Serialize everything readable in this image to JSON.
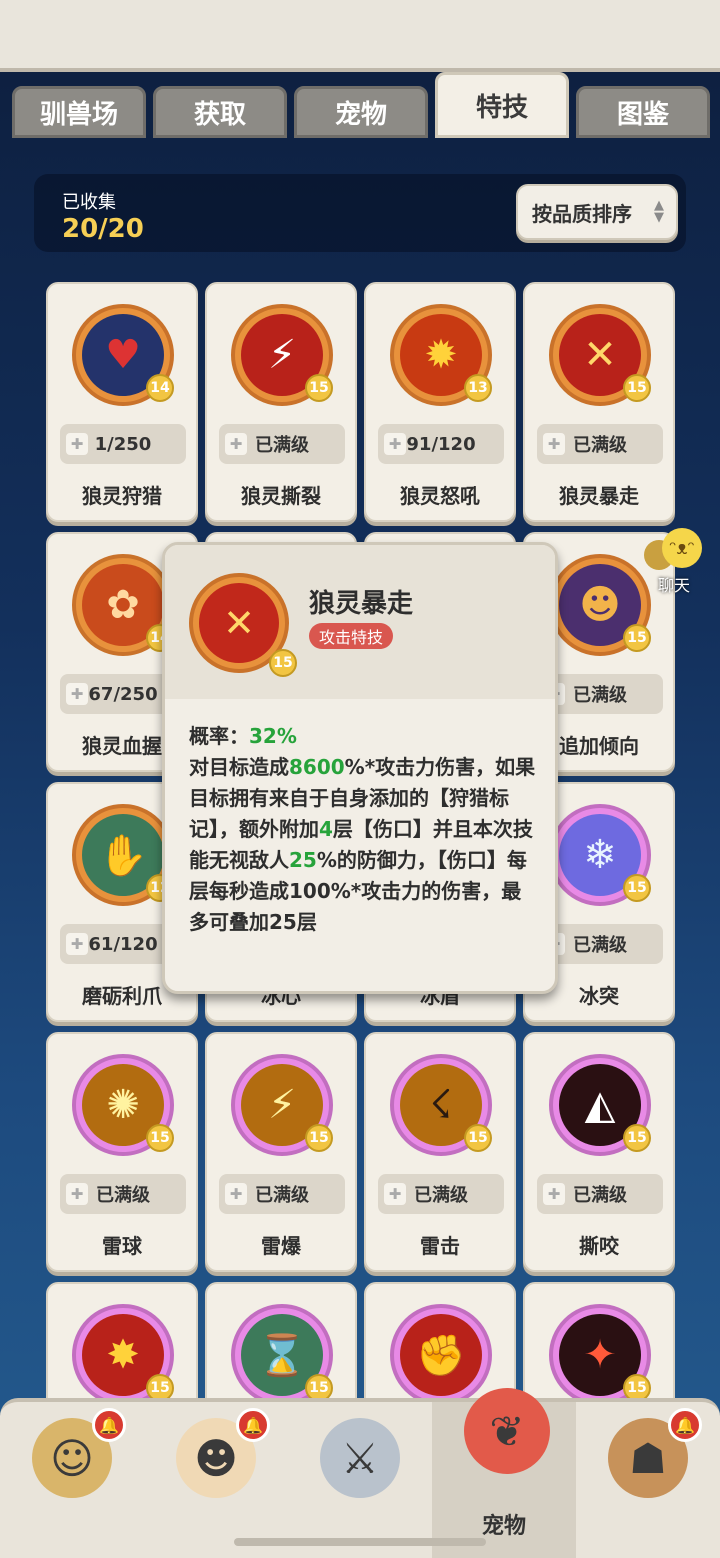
{
  "tabs": [
    {
      "label": "驯兽场"
    },
    {
      "label": "获取"
    },
    {
      "label": "宠物"
    },
    {
      "label": "特技"
    },
    {
      "label": "图鉴"
    }
  ],
  "collection": {
    "label": "已收集",
    "value": "20/20"
  },
  "sort": {
    "label": "按品质排序"
  },
  "skills": [
    {
      "name": "狼灵狩猎",
      "level": "14",
      "progress": "1/250",
      "icon": "heart-target-icon"
    },
    {
      "name": "狼灵撕裂",
      "level": "15",
      "progress": "已满级",
      "icon": "claw-slash-icon"
    },
    {
      "name": "狼灵怒吼",
      "level": "13",
      "progress": "91/120",
      "icon": "fire-roar-icon"
    },
    {
      "name": "狼灵暴走",
      "level": "15",
      "progress": "已满级",
      "icon": "rampage-slash-icon"
    },
    {
      "name": "狼灵血握",
      "level": "14",
      "progress": "67/250",
      "icon": "paw-icon"
    },
    {
      "name": "",
      "level": "",
      "progress": "",
      "icon": "hidden"
    },
    {
      "name": "",
      "level": "",
      "progress": "",
      "icon": "hidden"
    },
    {
      "name": "追加倾向",
      "level": "15",
      "progress": "已满级",
      "icon": "cat-face-icon"
    },
    {
      "name": "磨砺利爪",
      "level": "12",
      "progress": "61/120",
      "icon": "claw-sharpen-icon"
    },
    {
      "name": "冰心",
      "level": "",
      "progress": "",
      "icon": "hidden"
    },
    {
      "name": "冰盾",
      "level": "",
      "progress": "",
      "icon": "hidden"
    },
    {
      "name": "冰突",
      "level": "15",
      "progress": "已满级",
      "icon": "ice-crystal-icon"
    },
    {
      "name": "雷球",
      "level": "15",
      "progress": "已满级",
      "icon": "thunder-ball-icon"
    },
    {
      "name": "雷爆",
      "level": "15",
      "progress": "已满级",
      "icon": "thunder-burst-icon"
    },
    {
      "name": "雷击",
      "level": "15",
      "progress": "已满级",
      "icon": "thunder-strike-icon"
    },
    {
      "name": "撕咬",
      "level": "15",
      "progress": "已满级",
      "icon": "bite-icon"
    },
    {
      "name": "",
      "level": "15",
      "progress": "",
      "icon": "explosion-icon"
    },
    {
      "name": "",
      "level": "15",
      "progress": "",
      "icon": "hourglass-icon"
    },
    {
      "name": "",
      "level": "",
      "progress": "",
      "icon": "fist-icon"
    },
    {
      "name": "",
      "level": "15",
      "progress": "",
      "icon": "claw-red-icon"
    }
  ],
  "popup": {
    "title": "狼灵暴走",
    "tag": "攻击特技",
    "level": "15",
    "line1_a": "概率：",
    "line1_b": "32%",
    "line2_a": "对目标造成",
    "line2_b": "8600",
    "line2_c": "%*攻击力伤害，如果目标拥有来自于自身添加的【狩猎标记】，额外附加",
    "line2_d": "4",
    "line2_e": "层【伤口】并且本次技能无视敌人",
    "line2_f": "25",
    "line2_g": "%的防御力，【伤口】每层每秒造成100%*攻击力的伤害，最多可叠加25层"
  },
  "chat": {
    "label": "聊天"
  },
  "nav": [
    {
      "label": "",
      "icon": "beast-avatar-icon",
      "badge": true
    },
    {
      "label": "",
      "icon": "hero-avatar-icon",
      "badge": true
    },
    {
      "label": "",
      "icon": "sword-icon",
      "badge": false
    },
    {
      "label": "宠物",
      "icon": "dino-pet-icon",
      "badge": false
    },
    {
      "label": "",
      "icon": "monkey-king-icon",
      "badge": true
    }
  ]
}
